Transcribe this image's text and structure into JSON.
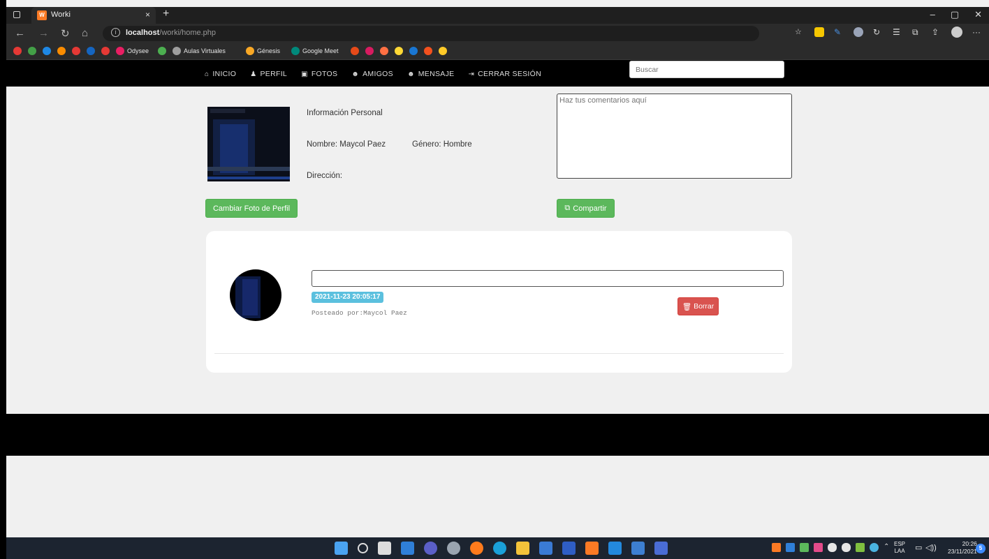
{
  "browser": {
    "tab_title": "Worki",
    "tab_favicon_text": "W",
    "new_tab_symbol": "+",
    "close_tab_symbol": "×",
    "url_host": "localhost",
    "url_path": "/worki/home.php",
    "window_controls": [
      "–",
      "▢",
      "✕"
    ],
    "bookmarks": [
      {
        "label": "",
        "color": "#e53935"
      },
      {
        "label": "",
        "color": "#43a047"
      },
      {
        "label": "",
        "color": "#1e88e5"
      },
      {
        "label": "",
        "color": "#fb8c00"
      },
      {
        "label": "",
        "color": "#e53935"
      },
      {
        "label": "",
        "color": "#1565c0"
      },
      {
        "label": "",
        "color": "#e53935"
      },
      {
        "label": "Odysee",
        "color": "#e91e63"
      },
      {
        "label": "",
        "color": "#4caf50"
      },
      {
        "label": "Aulas Virtuales",
        "color": "#9e9e9e"
      },
      {
        "label": "Génesis",
        "color": "#f9a825"
      },
      {
        "label": "Google Meet",
        "color": "#00897b"
      },
      {
        "label": "",
        "color": "#e64a19"
      },
      {
        "label": "",
        "color": "#d81b60"
      },
      {
        "label": "",
        "color": "#ff7043"
      },
      {
        "label": "",
        "color": "#fdd835"
      },
      {
        "label": "",
        "color": "#1976d2"
      },
      {
        "label": "",
        "color": "#f4511e"
      },
      {
        "label": "",
        "color": "#ffca28"
      }
    ]
  },
  "nav": {
    "links": [
      {
        "icon": "⌂",
        "label": "INICIO"
      },
      {
        "icon": "♟",
        "label": "PERFIL"
      },
      {
        "icon": "▣",
        "label": "FOTOS"
      },
      {
        "icon": "☻",
        "label": "AMIGOS"
      },
      {
        "icon": "☻",
        "label": "MENSAJE"
      },
      {
        "icon": "⇥",
        "label": "CERRAR SESIÓN"
      }
    ],
    "search_placeholder": "Buscar"
  },
  "profile": {
    "section_title": "Información Personal",
    "name": "Nombre: Maycol Paez",
    "gender": "Género: Hombre",
    "address": "Dirección:",
    "change_photo_label": "Cambiar Foto de Perfil"
  },
  "composer": {
    "placeholder": "Haz tus comentarios aquí",
    "share_label": "Compartir"
  },
  "post": {
    "timestamp": "2021-11-23 20:05:17",
    "posted_by": "Posteado por:Maycol Paez",
    "delete_label": "Borrar"
  },
  "taskbar": {
    "lang_top": "ESP",
    "lang_bottom": "LAA",
    "time": "20:26",
    "date": "23/11/2021",
    "notifications": "5"
  },
  "colors": {
    "green_button": "#5cb85c",
    "red_button": "#d9534f",
    "badge_blue": "#5bc0de",
    "navbar": "#000000"
  }
}
